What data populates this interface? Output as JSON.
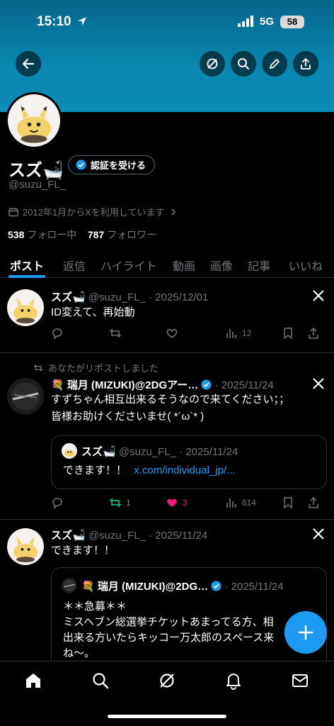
{
  "status_bar": {
    "time": "15:10",
    "network": "5G",
    "battery": "58"
  },
  "profile": {
    "name": "スズ🛁",
    "verify_label": "認証を受ける",
    "handle": "@suzu_FL_",
    "joined": "2012年1月からXを利用しています",
    "following_count": "538",
    "following_label": "フォロー中",
    "followers_count": "787",
    "followers_label": "フォロワー"
  },
  "tabs": [
    "ポスト",
    "返信",
    "ハイライト",
    "動画",
    "画像",
    "記事",
    "いいね"
  ],
  "posts": [
    {
      "name": "スズ🛁",
      "handle": "@suzu_FL_",
      "date": "· 2025/12/01",
      "text": "ID変えて、再始動",
      "views": "12"
    },
    {
      "repost_label": "あなたがリポストしました",
      "name": "💐 瑞月 (MIZUKI)@2DGアー…",
      "date": "· 2025/11/24",
      "text_line1": "すずちゃん相互出来るそうなので来てください；；",
      "text_line2": "皆様お助けくださいませ( *´ω`* )",
      "quote": {
        "name": "スズ🛁",
        "handle": "@suzu_FL_",
        "date": "· 2025/11/24",
        "text": "できます！！",
        "link": "x.com/individual_jp/..."
      },
      "reposts": "1",
      "likes": "3",
      "views": "614"
    },
    {
      "name": "スズ🛁",
      "handle": "@suzu_FL_",
      "date": "· 2025/11/24",
      "text": "できます！！",
      "quote": {
        "name": "💐 瑞月 (MIZUKI)@2DG…",
        "date": "· 2025/11/24",
        "line1": "＊＊急募＊＊",
        "line2": "ミスヘブン総選挙チケットあまってる方、相",
        "line3": "出来る方いたらキッコー万太郎のスペース来",
        "line4": "ね〜。"
      }
    }
  ],
  "colors": {
    "accent": "#1d9bf0",
    "banner": "#0a86b0",
    "like": "#f91880",
    "repost": "#00ba7c"
  }
}
